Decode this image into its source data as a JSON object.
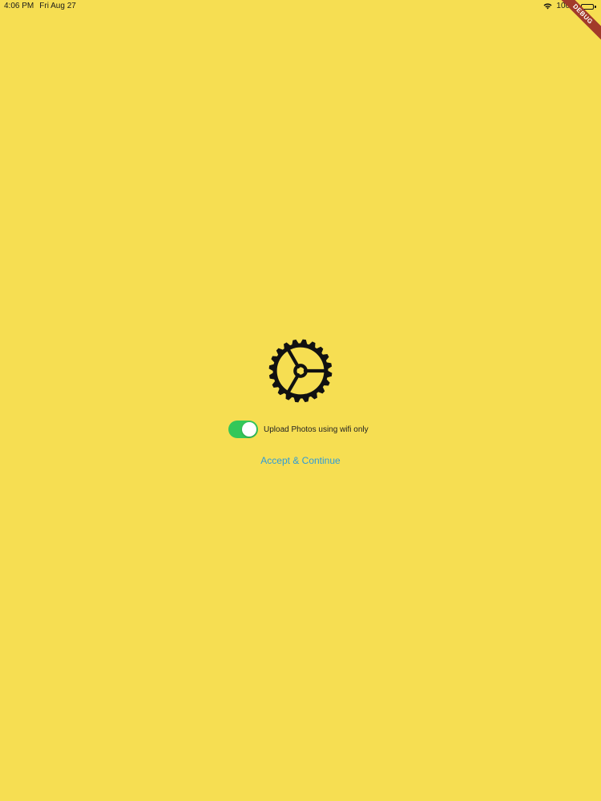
{
  "status_bar": {
    "time": "4:06 PM",
    "date": "Fri Aug 27",
    "battery": "100%",
    "wifi_icon": "wifi-icon",
    "battery_icon": "battery-icon"
  },
  "debug_banner": {
    "label": "DEBUG",
    "color": "#A23A2A"
  },
  "main": {
    "icon": "gear-icon",
    "wifi_toggle": {
      "label": "Upload Photos using wifi only",
      "checked": true,
      "on_color": "#34C759"
    },
    "accept_button": {
      "label": "Accept & Continue",
      "color": "#2E9BD8"
    }
  },
  "colors": {
    "background": "#F6DE52",
    "text": "#1a1a1a"
  }
}
